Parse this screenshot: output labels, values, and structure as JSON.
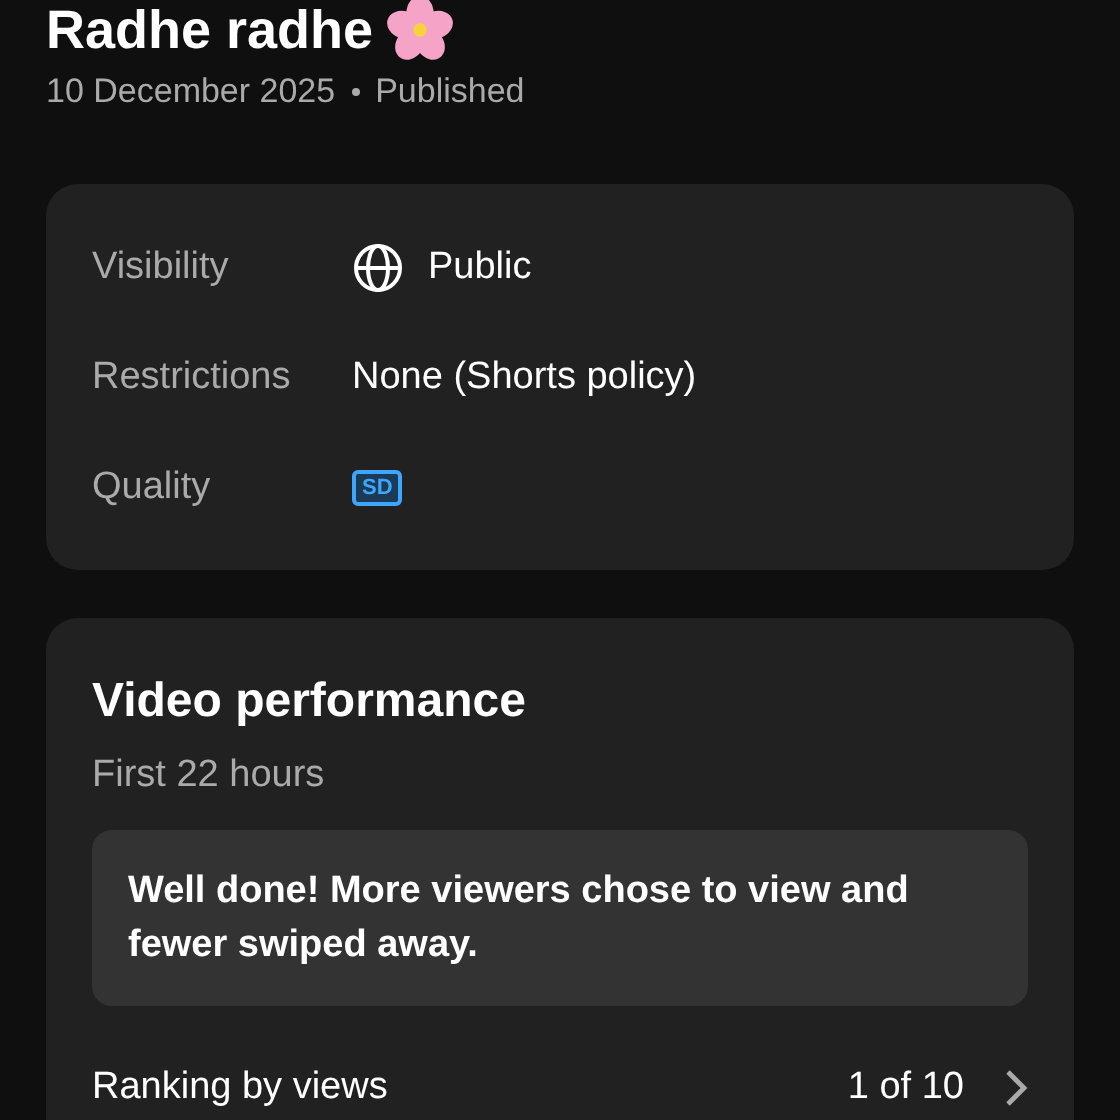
{
  "video": {
    "title": "Radhe radhe",
    "date": "10 December 2025",
    "status": "Published"
  },
  "details": [
    {
      "kind": "globe",
      "label": "Visibility",
      "value": "Public"
    },
    {
      "kind": "text",
      "label": "Restrictions",
      "value": "None (Shorts policy)"
    },
    {
      "kind": "badge",
      "label": "Quality",
      "value": "SD"
    }
  ],
  "performance": {
    "title": "Video performance",
    "subtitle": "First 22 hours",
    "message": "Well done! More viewers chose to view and fewer swiped away.",
    "ranking_label": "Ranking by views",
    "ranking_value": "1 of 10"
  }
}
